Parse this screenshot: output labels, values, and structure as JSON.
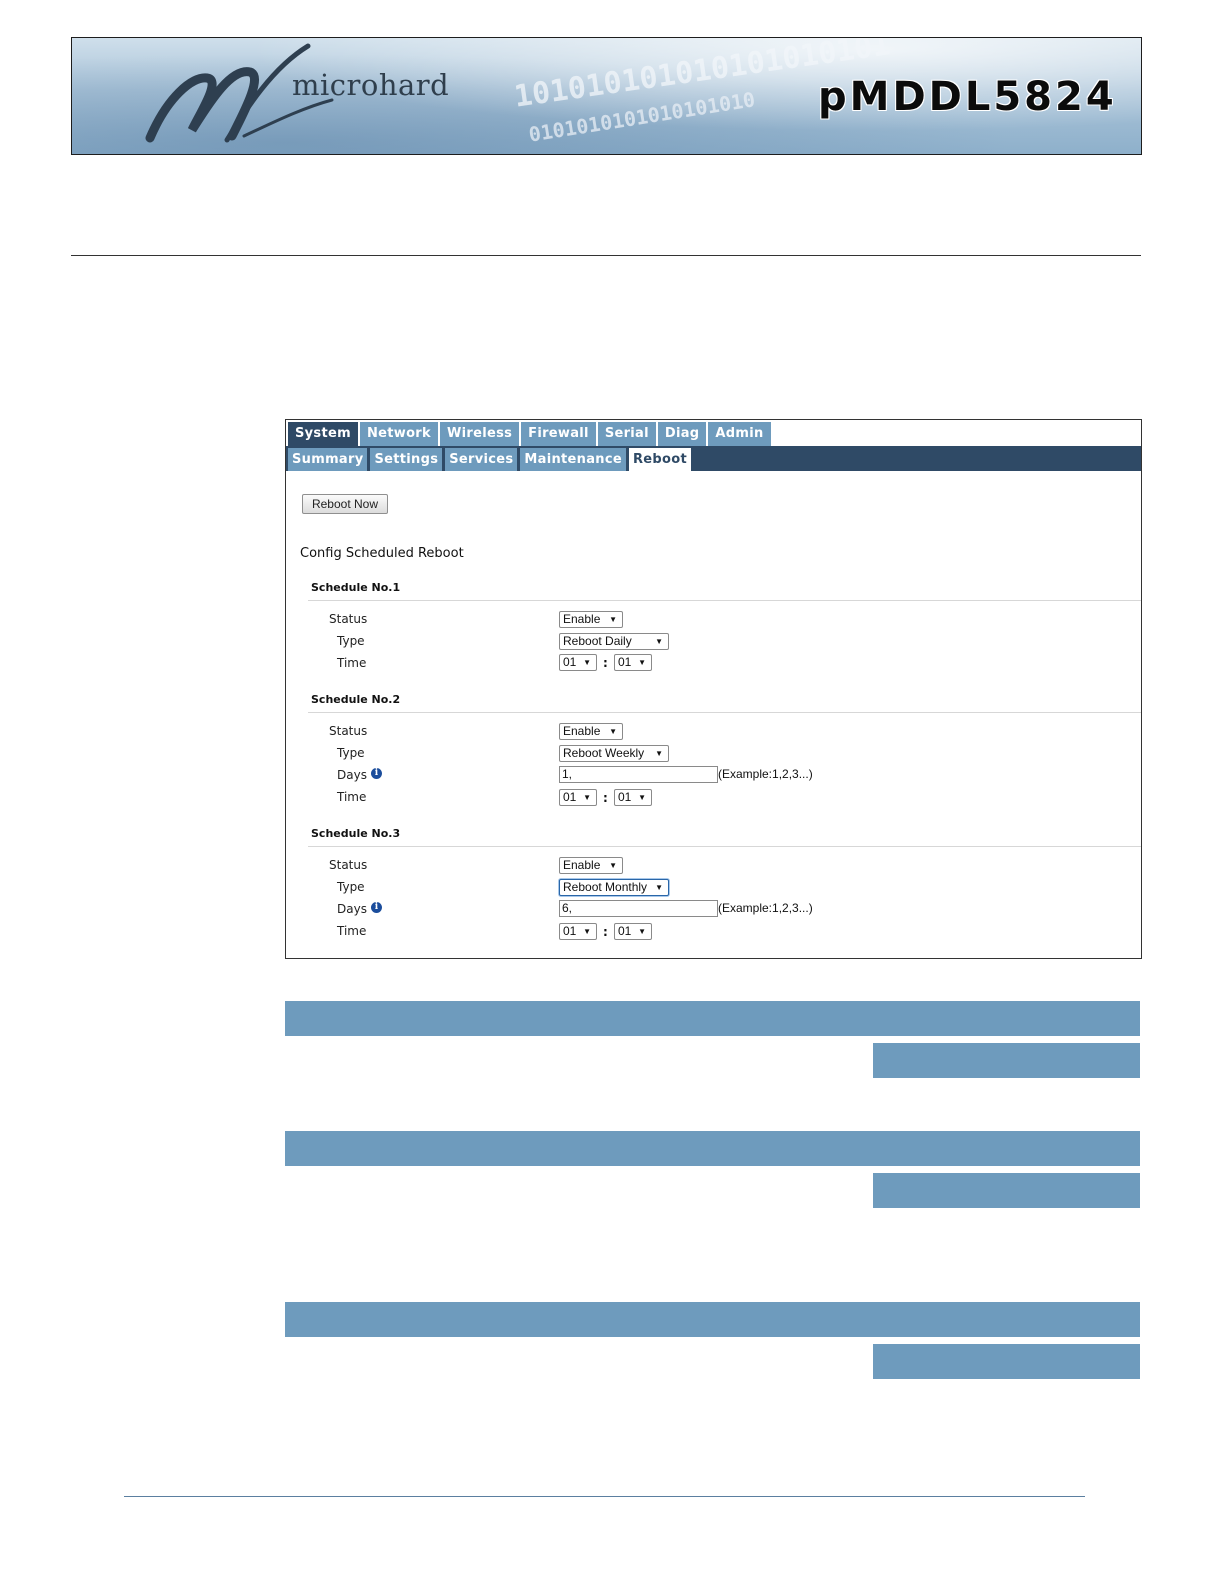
{
  "banner": {
    "brand": "microhard",
    "product": "pMDDL5824",
    "binary_1": "101010101010101010101",
    "binary_2": "0101010101010101010"
  },
  "tabs_main": [
    "System",
    "Network",
    "Wireless",
    "Firewall",
    "Serial",
    "Diag",
    "Admin"
  ],
  "tabs_main_active": "System",
  "tabs_sub": [
    "Summary",
    "Settings",
    "Services",
    "Maintenance",
    "Reboot"
  ],
  "tabs_sub_active": "Reboot",
  "reboot_now_label": "Reboot Now",
  "config_title": "Config Scheduled Reboot",
  "schedule1": {
    "title": "Schedule No.1",
    "status_label": "Status",
    "status_value": "Enable",
    "type_label": "Type",
    "type_value": "Reboot Daily",
    "time_label": "Time",
    "hour": "01",
    "minute": "01"
  },
  "schedule2": {
    "title": "Schedule No.2",
    "status_label": "Status",
    "status_value": "Enable",
    "type_label": "Type",
    "type_value": "Reboot Weekly",
    "days_label": "Days",
    "days_value": "1,",
    "days_example": "(Example:1,2,3...)",
    "time_label": "Time",
    "hour": "01",
    "minute": "01"
  },
  "schedule3": {
    "title": "Schedule No.3",
    "status_label": "Status",
    "status_value": "Enable",
    "type_label": "Type",
    "type_value": "Reboot Monthly",
    "days_label": "Days",
    "days_value": "6,",
    "days_example": "(Example:1,2,3...)",
    "time_label": "Time",
    "hour": "01",
    "minute": "01"
  },
  "colon": ":",
  "dropdown_glyph": "▼",
  "info_glyph": "i",
  "colors": {
    "tab_blue": "#6e9bbd",
    "tab_dark": "#2f4a66",
    "bar_blue": "#6e9bbd"
  }
}
